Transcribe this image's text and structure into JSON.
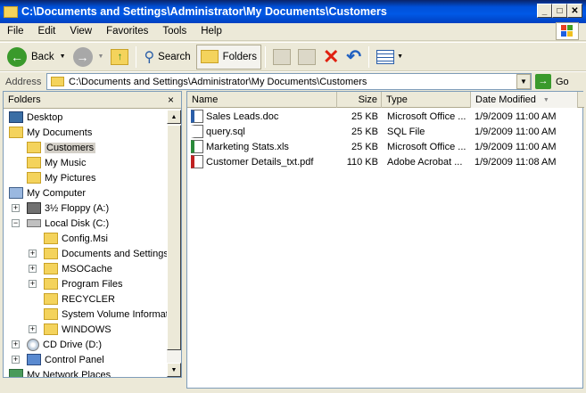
{
  "window": {
    "title": "C:\\Documents and Settings\\Administrator\\My Documents\\Customers"
  },
  "menu": [
    "File",
    "Edit",
    "View",
    "Favorites",
    "Tools",
    "Help"
  ],
  "toolbar": {
    "back_label": "Back",
    "search_label": "Search",
    "folders_label": "Folders"
  },
  "address": {
    "label": "Address",
    "value": "C:\\Documents and Settings\\Administrator\\My Documents\\Customers",
    "go_label": "Go"
  },
  "folders_pane": {
    "title": "Folders",
    "close": "×"
  },
  "tree": [
    {
      "label": "Desktop",
      "icon": "desktop-icon"
    },
    {
      "label": "My Documents",
      "icon": "folder-icon"
    },
    {
      "label": "Customers",
      "icon": "folder-icon"
    },
    {
      "label": "My Music",
      "icon": "folder-icon"
    },
    {
      "label": "My Pictures",
      "icon": "folder-icon"
    },
    {
      "label": "My Computer",
      "icon": "computer-icon"
    },
    {
      "label": "3½ Floppy (A:)",
      "icon": "floppy-icon",
      "expander": "+"
    },
    {
      "label": "Local Disk (C:)",
      "icon": "disk-icon",
      "expander": "−"
    },
    {
      "label": "Config.Msi",
      "icon": "folder-icon"
    },
    {
      "label": "Documents and Settings",
      "icon": "folder-icon",
      "expander": "+"
    },
    {
      "label": "MSOCache",
      "icon": "folder-icon",
      "expander": "+"
    },
    {
      "label": "Program Files",
      "icon": "folder-icon",
      "expander": "+"
    },
    {
      "label": "RECYCLER",
      "icon": "folder-icon"
    },
    {
      "label": "System Volume Informati",
      "icon": "folder-icon"
    },
    {
      "label": "WINDOWS",
      "icon": "folder-icon",
      "expander": "+"
    },
    {
      "label": "CD Drive (D:)",
      "icon": "cd-icon",
      "expander": "+"
    },
    {
      "label": "Control Panel",
      "icon": "control-panel-icon",
      "expander": "+"
    },
    {
      "label": "My Network Places",
      "icon": "network-icon"
    }
  ],
  "columns": {
    "name": "Name",
    "size": "Size",
    "type": "Type",
    "modified": "Date Modified"
  },
  "files": [
    {
      "name": "Sales Leads.doc",
      "size": "25 KB",
      "type": "Microsoft Office ...",
      "modified": "1/9/2009 11:00 AM",
      "icon": "word-doc-icon"
    },
    {
      "name": "query.sql",
      "size": "25 KB",
      "type": "SQL File",
      "modified": "1/9/2009 11:00 AM",
      "icon": "sql-file-icon"
    },
    {
      "name": "Marketing Stats.xls",
      "size": "25 KB",
      "type": "Microsoft Office ...",
      "modified": "1/9/2009 11:00 AM",
      "icon": "excel-file-icon"
    },
    {
      "name": "Customer Details_txt.pdf",
      "size": "110 KB",
      "type": "Adobe Acrobat ...",
      "modified": "1/9/2009 11:08 AM",
      "icon": "pdf-file-icon"
    }
  ]
}
